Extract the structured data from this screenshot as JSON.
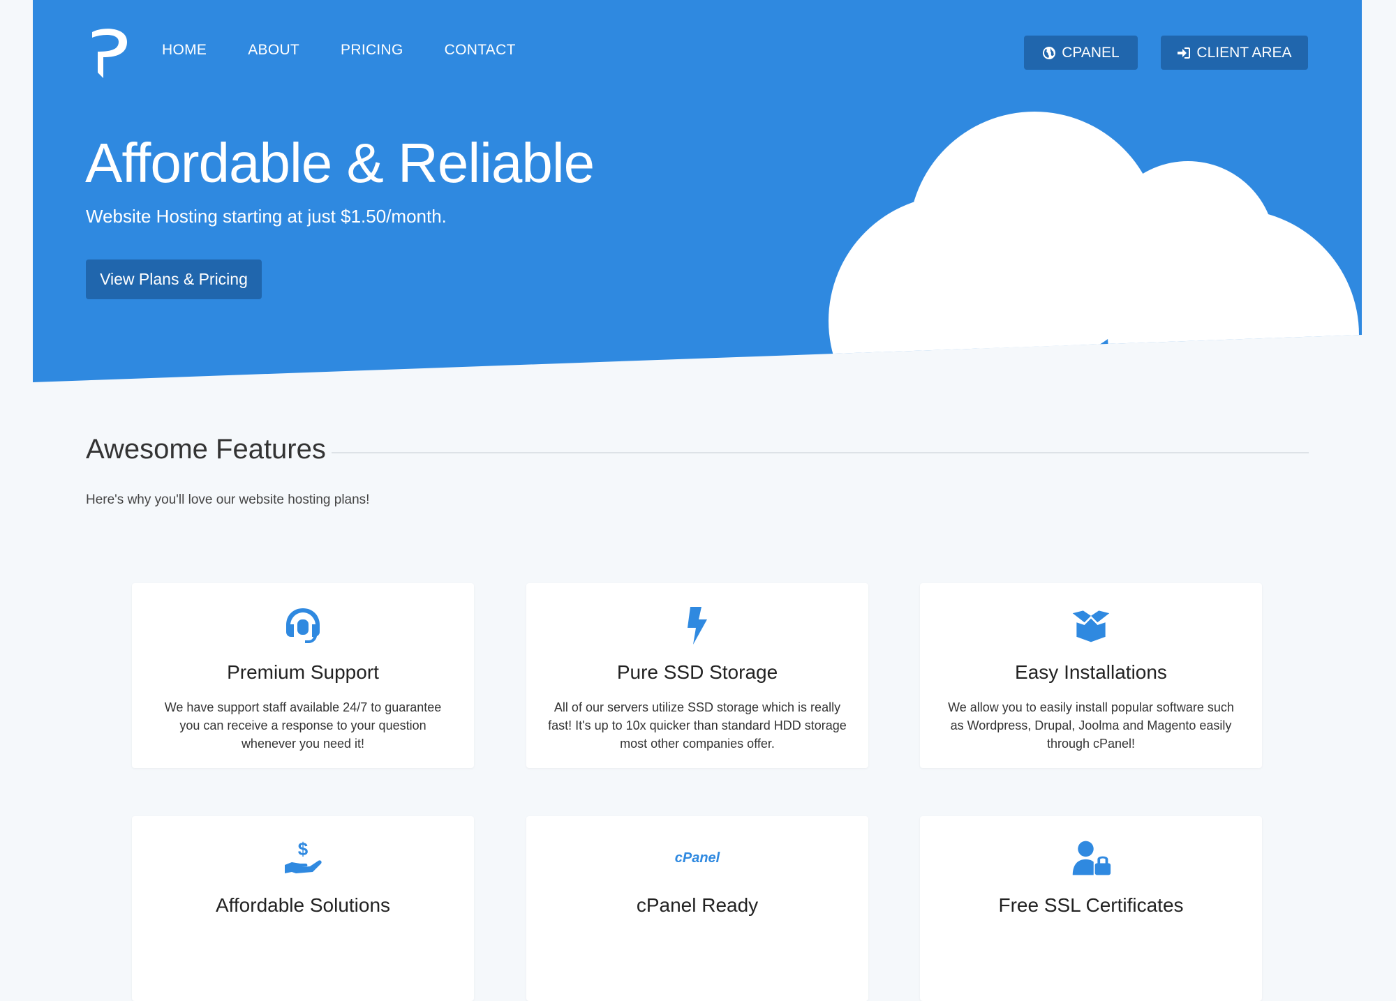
{
  "nav": {
    "items": [
      "HOME",
      "ABOUT",
      "PRICING",
      "CONTACT"
    ],
    "cpanel_label": "CPANEL",
    "client_area_label": "CLIENT AREA"
  },
  "hero": {
    "title": "Affordable & Reliable",
    "subtitle": "Website Hosting starting at just $1.50/month.",
    "cta_label": "View Plans & Pricing"
  },
  "features": {
    "title": "Awesome Features",
    "description": "Here's why you'll love our website hosting plans!",
    "cards": [
      {
        "icon": "headset-icon",
        "title": "Premium Support",
        "text": "We have support staff available 24/7 to guarantee you can receive a response to your question whenever you need it!"
      },
      {
        "icon": "bolt-icon",
        "title": "Pure SSD Storage",
        "text": "All of our servers utilize SSD storage which is really fast! It's up to 10x quicker than standard HDD storage most other companies offer."
      },
      {
        "icon": "box-open-icon",
        "title": "Easy Installations",
        "text": "We allow you to easily install popular software such as Wordpress, Drupal, Joolma and Magento easily through cPanel!"
      },
      {
        "icon": "hand-dollar-icon",
        "title": "Affordable Solutions",
        "text": ""
      },
      {
        "icon": "cpanel-icon",
        "title": "cPanel Ready",
        "text": ""
      },
      {
        "icon": "user-lock-icon",
        "title": "Free SSL Certificates",
        "text": ""
      }
    ]
  },
  "colors": {
    "brand": "#2f89e0",
    "button_dark": "#2066ad",
    "background": "#f5f8fb"
  }
}
